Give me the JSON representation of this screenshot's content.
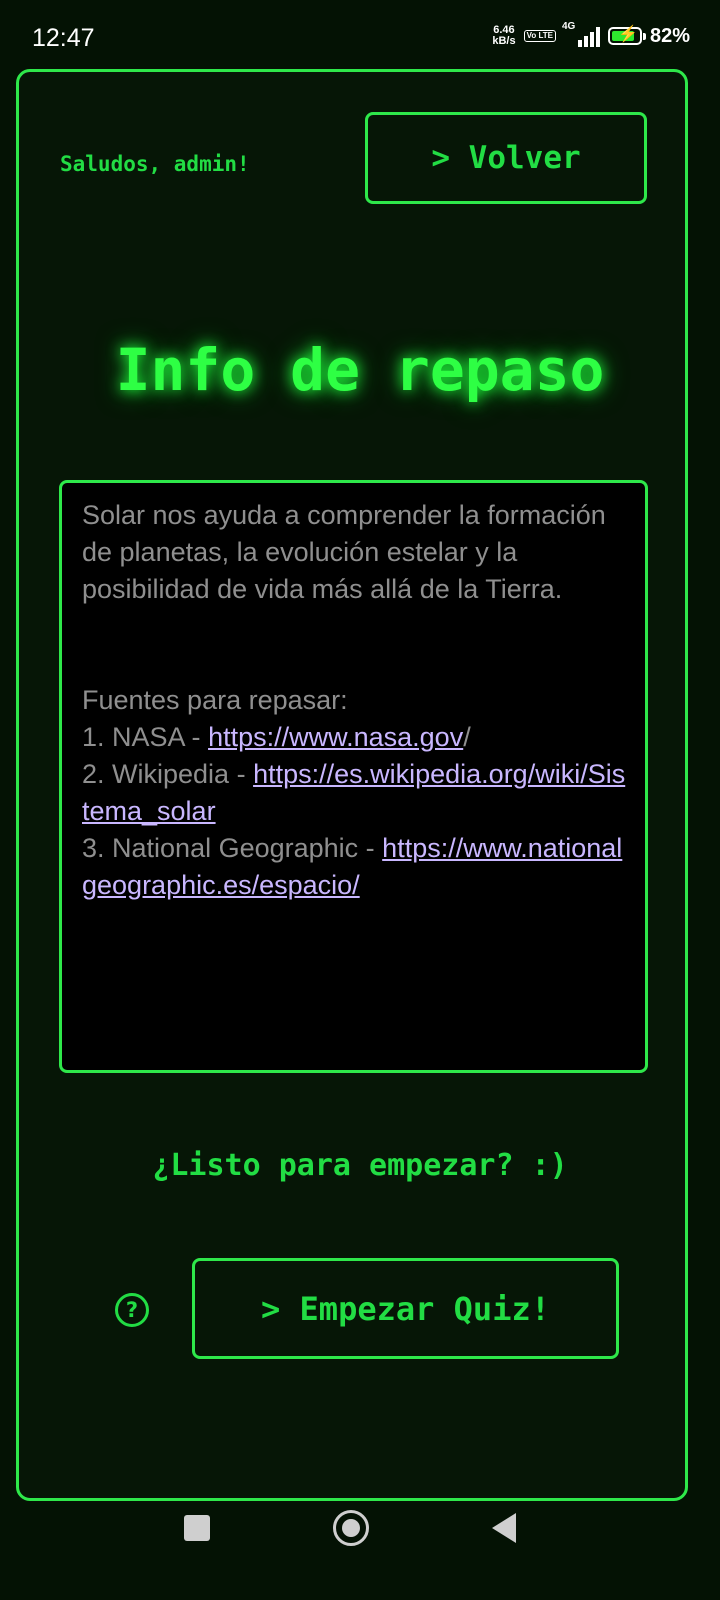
{
  "status_bar": {
    "time": "12:47",
    "net_speed_value": "6.46",
    "net_speed_unit": "kB/s",
    "volte": "Vo LTE",
    "network": "4G",
    "battery_percent": "82%",
    "battery_level": 0.82
  },
  "header": {
    "greeting": "Saludos, admin!",
    "back_button_label": "> Volver"
  },
  "title": "Info de repaso",
  "info": {
    "intro": "Solar nos ayuda a comprender la formación de planetas, la evolución estelar y la posibilidad de vida más allá de la Tierra.",
    "sources_heading": "Fuentes para repasar:",
    "sources": [
      {
        "prefix": "1. NASA - ",
        "url": "https://www.nasa.gov",
        "suffix": "/"
      },
      {
        "prefix": "2. Wikipedia - ",
        "url": "https://es.wikipedia.org/wiki/Sistema_solar",
        "suffix": ""
      },
      {
        "prefix": "3. National Geographic - ",
        "url": "https://www.nationalgeographic.es/espacio/",
        "suffix": ""
      }
    ]
  },
  "ready_text": "¿Listo para empezar? :)",
  "help_icon_glyph": "?",
  "start_button_label": "> Empezar Quiz!",
  "colors": {
    "accent_green": "#2ee84a",
    "background": "#041204",
    "info_text": "#8f8f8f",
    "link": "#c9b7ff"
  }
}
